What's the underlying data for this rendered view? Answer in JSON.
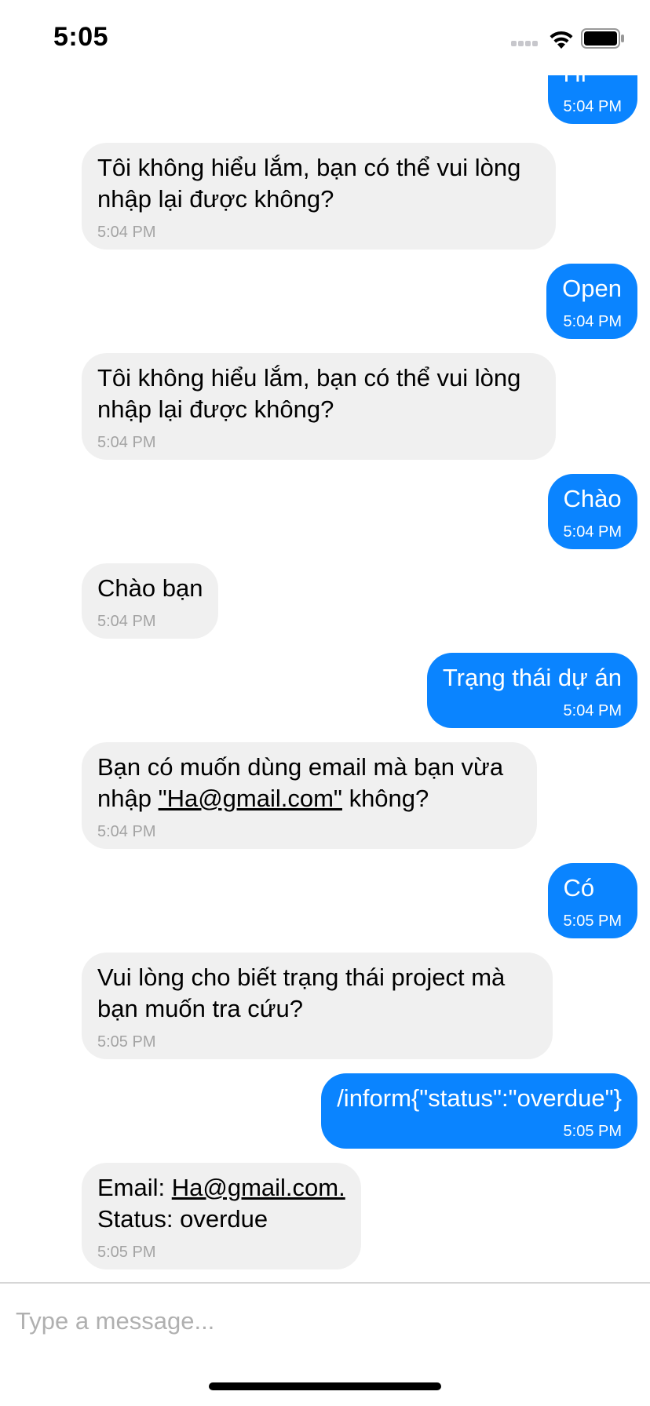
{
  "status_bar": {
    "time": "5:05"
  },
  "messages": [
    {
      "side": "out",
      "text": "Hi",
      "time": "5:04 PM"
    },
    {
      "side": "in",
      "text": "Tôi không hiểu lắm, bạn có thể vui lòng nhập lại được không?",
      "time": "5:04 PM"
    },
    {
      "side": "out",
      "text": "Open",
      "time": "5:04 PM"
    },
    {
      "side": "in",
      "text": "Tôi không hiểu lắm, bạn có thể vui lòng nhập lại được không?",
      "time": "5:04 PM"
    },
    {
      "side": "out",
      "text": "Chào",
      "time": "5:04 PM"
    },
    {
      "side": "in",
      "text": "Chào bạn",
      "time": "5:04 PM"
    },
    {
      "side": "out",
      "text": "Trạng thái dự án",
      "time": "5:04 PM"
    },
    {
      "side": "in",
      "text_before": "Bạn có muốn dùng email mà bạn vừa nhập ",
      "link": "\"Ha@gmail.com\"",
      "text_after": " không?",
      "time": "5:04 PM"
    },
    {
      "side": "out",
      "text": "Có",
      "time": "5:05 PM"
    },
    {
      "side": "in",
      "text": "Vui lòng cho biết trạng thái project mà bạn muốn tra cứu?",
      "time": "5:05 PM"
    },
    {
      "side": "out",
      "text": "/inform{\"status\":\"overdue\"}",
      "time": "5:05 PM"
    },
    {
      "side": "in",
      "text_before": "Email: ",
      "link": "Ha@gmail.com.",
      "text_after": "\nStatus: overdue",
      "time": "5:05 PM"
    }
  ],
  "composer": {
    "placeholder": "Type a message..."
  },
  "colors": {
    "outgoing_bubble": "#0a84ff",
    "incoming_bubble": "#f0f0f0"
  },
  "icons": [
    "signal-icon",
    "wifi-icon",
    "battery-icon"
  ]
}
